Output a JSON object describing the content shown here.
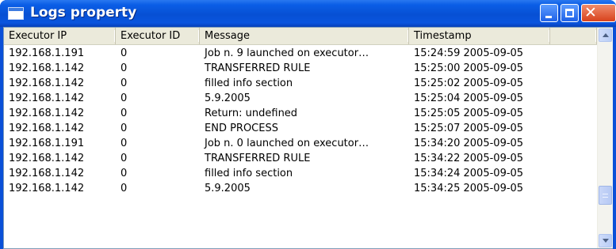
{
  "window": {
    "title": "Logs property"
  },
  "table": {
    "columns": [
      "Executor IP",
      "Executor ID",
      "Message",
      "Timestamp",
      ""
    ],
    "rows": [
      {
        "ip": "192.168.1.191",
        "id": "0",
        "message": "Job n. 9 launched on executor…",
        "timestamp": "15:24:59 2005-09-05"
      },
      {
        "ip": "192.168.1.142",
        "id": "0",
        "message": "TRANSFERRED RULE",
        "timestamp": "15:25:00 2005-09-05"
      },
      {
        "ip": "192.168.1.142",
        "id": "0",
        "message": "filled info section",
        "timestamp": "15:25:02 2005-09-05"
      },
      {
        "ip": "192.168.1.142",
        "id": "0",
        "message": "5.9.2005",
        "timestamp": "15:25:04 2005-09-05"
      },
      {
        "ip": "192.168.1.142",
        "id": "0",
        "message": "Return: undefined",
        "timestamp": "15:25:05 2005-09-05"
      },
      {
        "ip": "192.168.1.142",
        "id": "0",
        "message": "END PROCESS",
        "timestamp": "15:25:07 2005-09-05"
      },
      {
        "ip": "192.168.1.191",
        "id": "0",
        "message": "Job n. 0 launched on executor…",
        "timestamp": "15:34:20 2005-09-05"
      },
      {
        "ip": "192.168.1.142",
        "id": "0",
        "message": "TRANSFERRED RULE",
        "timestamp": "15:34:22 2005-09-05"
      },
      {
        "ip": "192.168.1.142",
        "id": "0",
        "message": "filled info section",
        "timestamp": "15:34:24 2005-09-05"
      },
      {
        "ip": "192.168.1.142",
        "id": "0",
        "message": "5.9.2005",
        "timestamp": "15:34:25 2005-09-05"
      }
    ]
  },
  "icons": {
    "window": "window-icon",
    "minimize": "minimize-icon",
    "maximize": "maximize-icon",
    "close": "close-icon",
    "scroll_up": "chevron-up-icon",
    "scroll_down": "chevron-down-icon"
  },
  "colors": {
    "titlebar": "#0750d4",
    "close_button": "#d8421c",
    "header_bg": "#ebeadb"
  }
}
